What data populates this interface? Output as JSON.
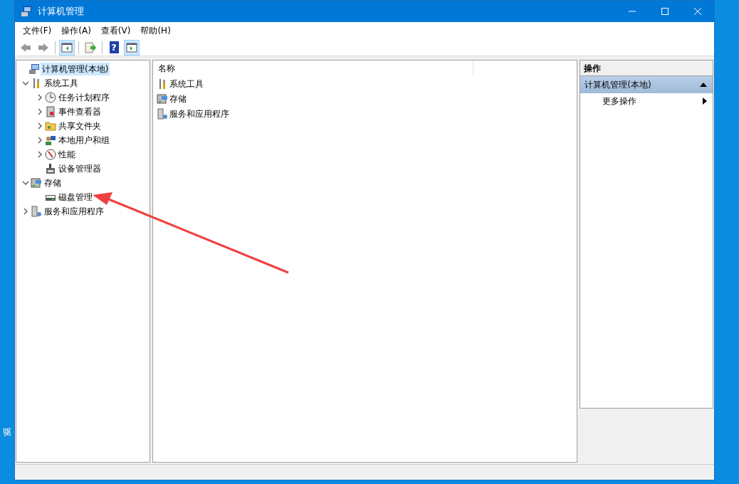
{
  "window": {
    "title": "计算机管理"
  },
  "menu": [
    "文件(F)",
    "操作(A)",
    "查看(V)",
    "帮助(H)"
  ],
  "toolbar": [
    {
      "kind": "back",
      "pressed": false
    },
    {
      "kind": "forward",
      "pressed": false
    },
    {
      "kind": "tree",
      "pressed": true
    },
    {
      "kind": "export",
      "pressed": false
    },
    {
      "kind": "help",
      "label": "?",
      "pressed": false
    },
    {
      "kind": "actionpane",
      "pressed": true
    }
  ],
  "tree": [
    {
      "label": "计算机管理(本地)",
      "kind": "computer",
      "selected": true,
      "children": [
        {
          "label": "系统工具",
          "kind": "tools",
          "selected": false,
          "expanded": true,
          "children": [
            {
              "label": "任务计划程序",
              "kind": "clock",
              "selected": false,
              "expanded": false
            },
            {
              "label": "事件查看器",
              "kind": "log",
              "selected": false,
              "expanded": false
            },
            {
              "label": "共享文件夹",
              "kind": "folder",
              "selected": false,
              "expanded": false
            },
            {
              "label": "本地用户和组",
              "kind": "users",
              "selected": false,
              "expanded": false
            },
            {
              "label": "性能",
              "kind": "gauge",
              "selected": false,
              "expanded": false
            },
            {
              "label": "设备管理器",
              "kind": "device",
              "selected": false
            }
          ]
        },
        {
          "label": "存储",
          "kind": "storage",
          "selected": false,
          "expanded": true,
          "children": [
            {
              "label": "磁盘管理",
              "kind": "disk",
              "selected": false
            }
          ]
        },
        {
          "label": "服务和应用程序",
          "kind": "server",
          "selected": false,
          "expanded": false
        }
      ]
    }
  ],
  "list": {
    "column": "名称",
    "items": [
      {
        "label": "系统工具",
        "kind": "tools"
      },
      {
        "label": "存储",
        "kind": "storage"
      },
      {
        "label": "服务和应用程序",
        "kind": "server"
      }
    ]
  },
  "actions": {
    "title": "操作",
    "section": "计算机管理(本地)",
    "items": [
      "更多操作"
    ]
  },
  "desktop": {
    "labels": [
      "驱"
    ]
  }
}
